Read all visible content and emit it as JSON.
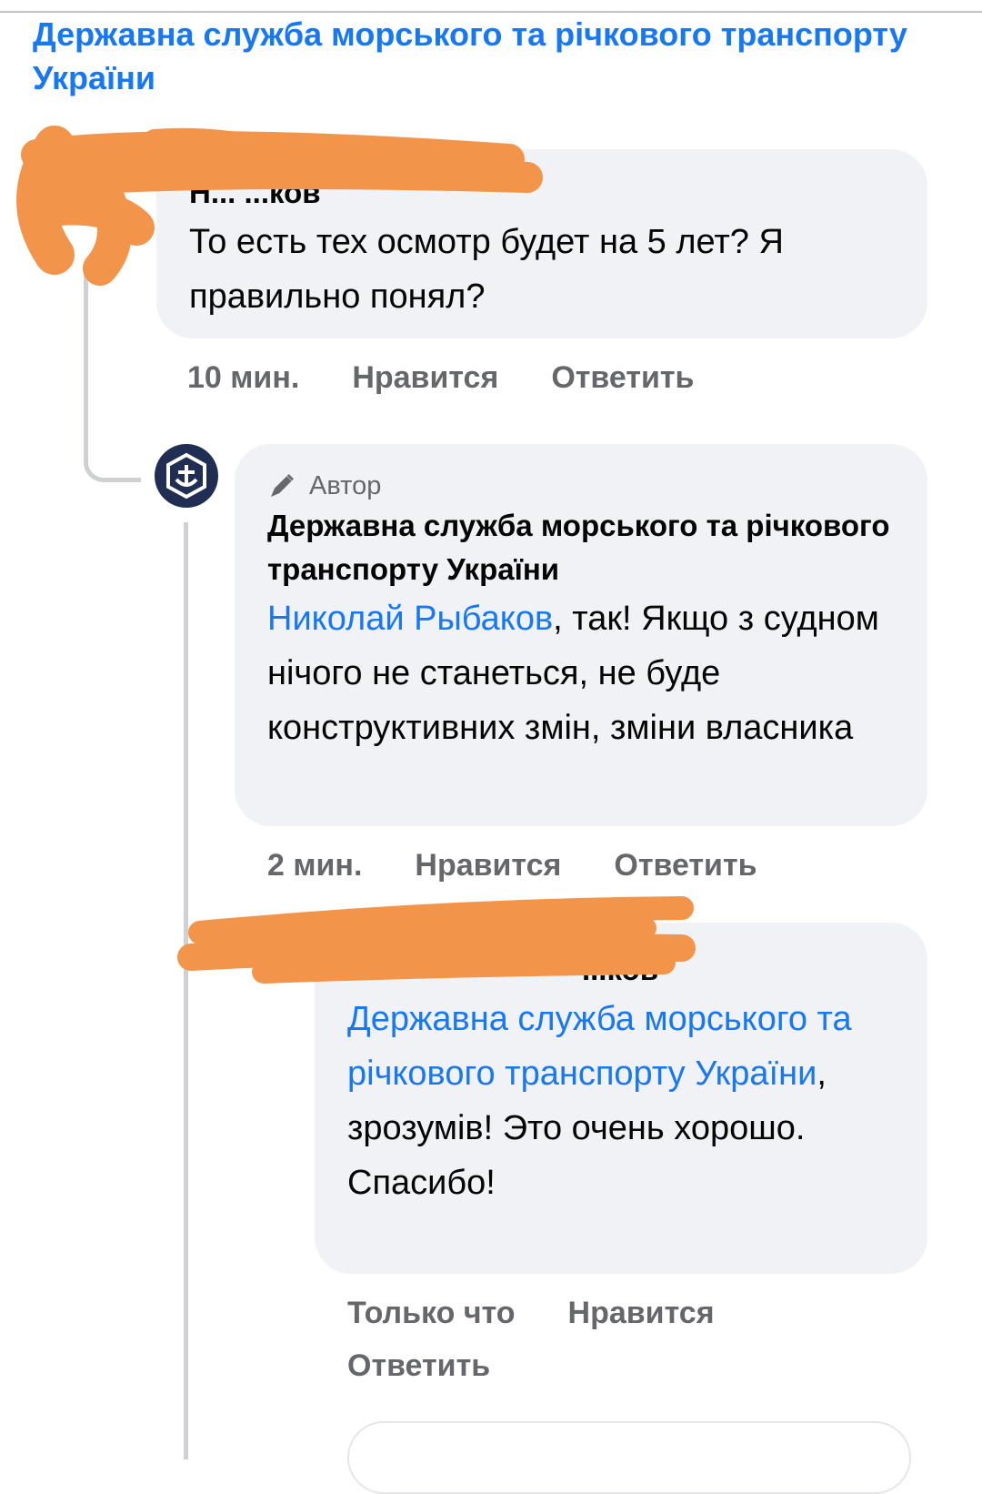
{
  "page": {
    "title": "Державна служба морського та річкового транспорту України"
  },
  "comment1": {
    "author": "Н... ...ков",
    "text": "То есть тех осмотр будет на 5 лет? Я правильно понял?",
    "time": "10 мин.",
    "like": "Нравится",
    "reply": "Ответить"
  },
  "comment2": {
    "badge": "Автор",
    "author": "Державна служба морського та річкового транспорту України",
    "mention": "Николай Рыбаков",
    "text": ", так! Якщо з судном нічого не станеться, не буде конструктивних змін, зміни власника",
    "time": "2 мин.",
    "like": "Нравится",
    "reply": "Ответить"
  },
  "comment3": {
    "author": "...ков",
    "mention": "Державна служба морського та річкового транспорту України",
    "punct": ",",
    "text": "зрозумів! Это очень хорошо. Спасибо!",
    "time": "Только что",
    "like": "Нравится",
    "reply": "Ответить"
  },
  "colors": {
    "link": "#1877f2",
    "bubble": "#f0f2f5",
    "redaction": "#f2944a",
    "muted": "#65676b"
  },
  "icons": {
    "author_badge": "pencil-icon",
    "page_avatar": "maritime-logo-icon"
  }
}
